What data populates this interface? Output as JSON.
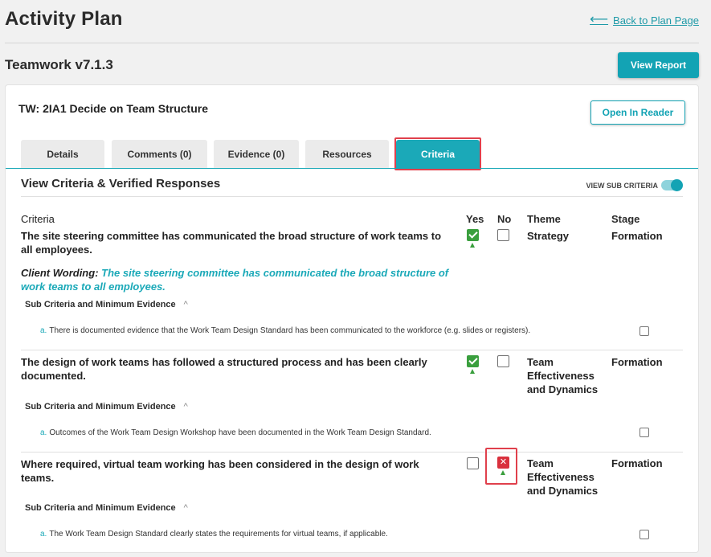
{
  "page": {
    "title": "Activity Plan",
    "back_link": "Back to Plan Page"
  },
  "plan": {
    "name": "Teamwork v7.1.3",
    "view_report": "View Report"
  },
  "card": {
    "title": "TW: 2IA1 Decide on Team Structure",
    "open_reader": "Open In Reader",
    "tabs": [
      {
        "label": "Details"
      },
      {
        "label": "Comments (0)"
      },
      {
        "label": "Evidence (0)"
      },
      {
        "label": "Resources"
      },
      {
        "label": "Criteria",
        "active": true
      }
    ]
  },
  "criteria_section": {
    "title": "View Criteria & Verified Responses",
    "toggle_label": "VIEW SUB CRITERIA",
    "toggle_on": true,
    "columns": {
      "criteria": "Criteria",
      "yes": "Yes",
      "no": "No",
      "theme": "Theme",
      "stage": "Stage"
    },
    "sub_heading": "Sub Criteria and Minimum Evidence",
    "rows": [
      {
        "text": "The site steering committee has communicated the broad structure of work teams to all employees.",
        "yes": true,
        "no": false,
        "theme": "Strategy",
        "stage": "Formation",
        "client_label": "Client Wording:",
        "client_text": "The site steering committee has communicated the broad structure of work teams to all employees.",
        "sub_items": [
          {
            "letter": "a.",
            "text": "There is documented evidence that the Work Team Design Standard has been communicated to the workforce (e.g. slides or registers).",
            "checked": false
          }
        ]
      },
      {
        "text": "The design of work teams has followed a structured process and has been clearly documented.",
        "yes": true,
        "no": false,
        "theme": "Team Effectiveness and Dynamics",
        "stage": "Formation",
        "sub_items": [
          {
            "letter": "a.",
            "text": "Outcomes of the Work Team Design Workshop have been documented in the Work Team Design Standard.",
            "checked": false
          }
        ]
      },
      {
        "text": "Where required, virtual team working has been considered in the design of work teams.",
        "yes": false,
        "no": true,
        "theme": "Team Effectiveness and Dynamics",
        "stage": "Formation",
        "sub_items": [
          {
            "letter": "a.",
            "text": "The Work Team Design Standard clearly states the requirements for virtual teams, if applicable.",
            "checked": false
          }
        ]
      }
    ]
  },
  "colors": {
    "accent": "#13a3b4",
    "yes_green": "#3a9f3e",
    "no_red": "#d9303d",
    "highlight": "#e0404c"
  }
}
